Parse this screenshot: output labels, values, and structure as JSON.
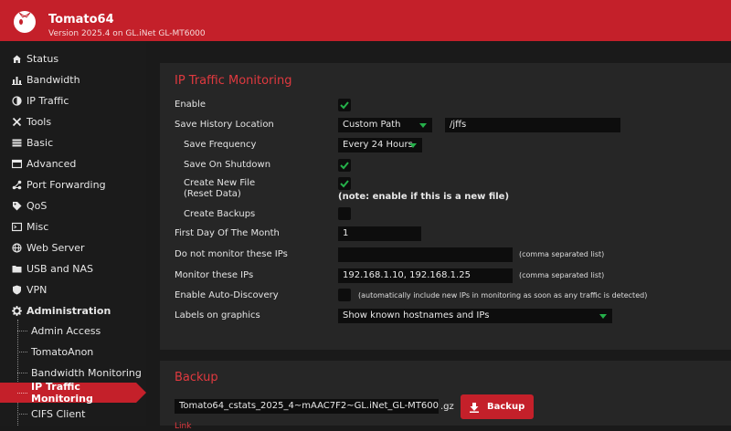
{
  "app": {
    "title": "Tomato64",
    "version": "Version 2025.4 on GL.iNet GL-MT6000"
  },
  "colors": {
    "brand": "#c4202a",
    "check": "#25b04a",
    "title_red": "#e0393f"
  },
  "sidebar": {
    "items": [
      {
        "label": "Status",
        "icon": "home-icon"
      },
      {
        "label": "Bandwidth",
        "icon": "bar-chart-icon"
      },
      {
        "label": "IP Traffic",
        "icon": "pie-icon"
      },
      {
        "label": "Tools",
        "icon": "tools-icon"
      },
      {
        "label": "Basic",
        "icon": "sliders-icon"
      },
      {
        "label": "Advanced",
        "icon": "advanced-icon"
      },
      {
        "label": "Port Forwarding",
        "icon": "port-forward-icon"
      },
      {
        "label": "QoS",
        "icon": "tag-icon"
      },
      {
        "label": "Misc",
        "icon": "misc-icon"
      },
      {
        "label": "Web Server",
        "icon": "globe-icon"
      },
      {
        "label": "USB and NAS",
        "icon": "folder-icon"
      },
      {
        "label": "VPN",
        "icon": "shield-icon"
      },
      {
        "label": "Administration",
        "icon": "gear-icon"
      }
    ],
    "admin_items": [
      {
        "label": "Admin Access"
      },
      {
        "label": "TomatoAnon"
      },
      {
        "label": "Bandwidth Monitoring"
      },
      {
        "label": "IP Traffic Monitoring"
      },
      {
        "label": "CIFS Client"
      }
    ]
  },
  "monitoring": {
    "title": "IP Traffic Monitoring",
    "enable_label": "Enable",
    "enable_checked": true,
    "save_location_label": "Save History Location",
    "save_location_value": "Custom Path",
    "path_value": "/jffs",
    "save_frequency_label": "Save Frequency",
    "save_frequency_value": "Every 24 Hours",
    "save_shutdown_label": "Save On Shutdown",
    "save_shutdown_checked": true,
    "create_new_label_1": "Create New File",
    "create_new_label_2": "(Reset Data)",
    "create_new_checked": true,
    "create_new_note": "(note: enable if this is a new file)",
    "create_backups_label": "Create Backups",
    "create_backups_checked": false,
    "first_day_label": "First Day Of The Month",
    "first_day_value": "1",
    "exclude_ips_label": "Do not monitor these IPs",
    "exclude_ips_value": "",
    "exclude_ips_hint": "(comma separated list)",
    "monitor_ips_label": "Monitor these IPs",
    "monitor_ips_value": "192.168.1.10, 192.168.1.25",
    "monitor_ips_hint": "(comma separated list)",
    "auto_discovery_label": "Enable Auto-Discovery",
    "auto_discovery_checked": false,
    "auto_discovery_hint": "(automatically include new IPs in monitoring as soon as any traffic is detected)",
    "labels_graphics_label": "Labels on graphics",
    "labels_graphics_value": "Show known hostnames and IPs"
  },
  "backup": {
    "title": "Backup",
    "filename": "Tomato64_cstats_2025_4~mAAC7F2~GL.iNet_GL-MT6000",
    "ext": ".gz",
    "button_label": "Backup",
    "link_text": "Link"
  }
}
